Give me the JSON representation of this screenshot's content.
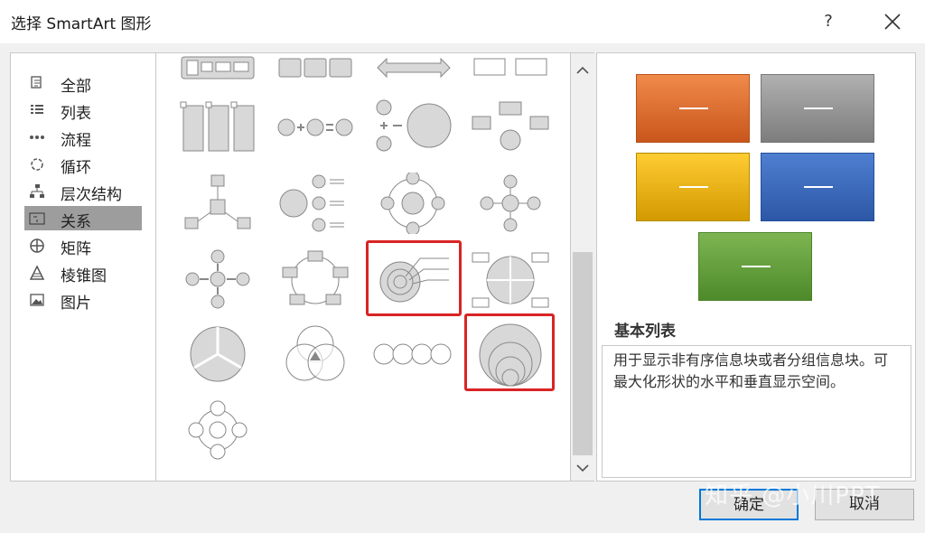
{
  "dialog": {
    "title": "选择 SmartArt 图形",
    "help_label": "?"
  },
  "categories": [
    {
      "label": "全部",
      "icon": "all-icon"
    },
    {
      "label": "列表",
      "icon": "list-icon"
    },
    {
      "label": "流程",
      "icon": "process-icon"
    },
    {
      "label": "循环",
      "icon": "cycle-icon"
    },
    {
      "label": "层次结构",
      "icon": "hierarchy-icon"
    },
    {
      "label": "关系",
      "icon": "relationship-icon",
      "selected": true
    },
    {
      "label": "矩阵",
      "icon": "matrix-icon"
    },
    {
      "label": "棱锥图",
      "icon": "pyramid-icon"
    },
    {
      "label": "图片",
      "icon": "picture-icon"
    }
  ],
  "preview": {
    "title": "基本列表",
    "description": "用于显示非有序信息块或者分组信息块。可最大化形状的水平和垂直显示空间。",
    "box_label": "—",
    "colors": {
      "orange": "#e06f2d",
      "gray": "#949494",
      "yellow": "#f2b416",
      "blue": "#3a68b9",
      "green": "#67a03e"
    }
  },
  "buttons": {
    "ok": "确定",
    "cancel": "取消"
  },
  "watermark": "知乎 @小川PPT",
  "highlight_color": "#d82424"
}
